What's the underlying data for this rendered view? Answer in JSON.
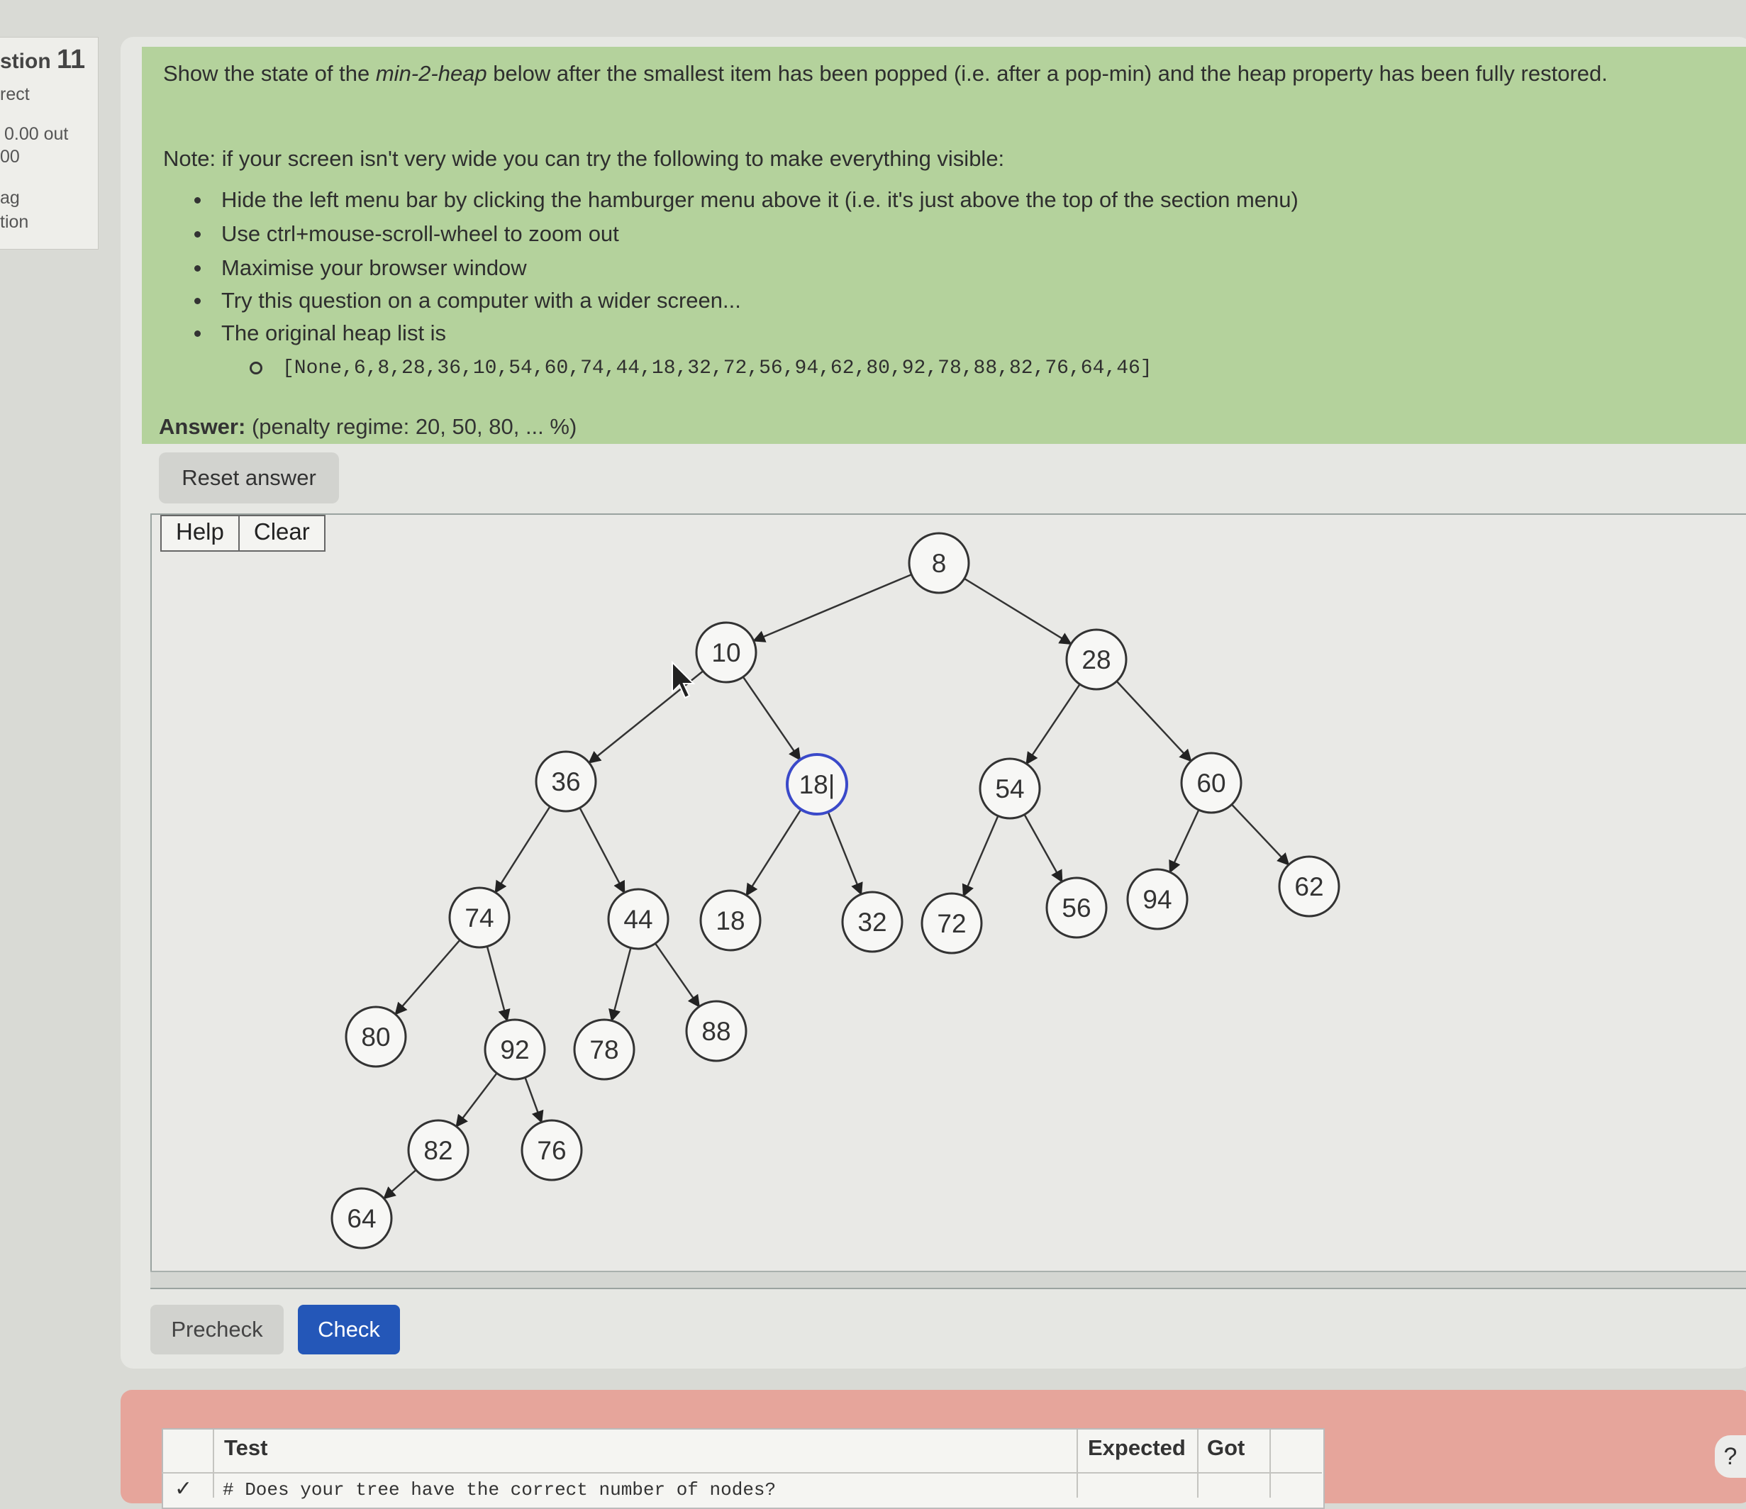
{
  "sidebar": {
    "question_word": "stion",
    "question_number": "11",
    "status": "rect",
    "mark": "0.00 out",
    "mark_total": "00",
    "flag_line1": "ag",
    "flag_line2": "tion"
  },
  "question": {
    "prompt_before": "Show the state of the ",
    "prompt_emph": "min-2-heap",
    "prompt_after": " below after the smallest item has been popped (i.e. after a pop-min) and the heap property has been fully restored.",
    "note": "Note: if your screen isn't very wide you can try the following to make everything visible:",
    "bullets": [
      "Hide the left menu bar by clicking the hamburger menu above it (i.e. it's just above the top of the section menu)",
      "Use ctrl+mouse-scroll-wheel to zoom out",
      "Maximise your browser window",
      "Try this question on a computer with a wider screen...",
      "The original heap list is"
    ],
    "heap_list": "[None,6,8,28,36,10,54,60,74,44,18,32,72,56,94,62,80,92,78,88,82,76,64,46]",
    "answer_label": "Answer:",
    "penalty": "(penalty regime: 20, 50, 80, ... %)"
  },
  "editor": {
    "reset_label": "Reset answer",
    "help_label": "Help",
    "clear_label": "Clear"
  },
  "tree": {
    "nodes": [
      {
        "id": "n8",
        "label": "8",
        "selected": false
      },
      {
        "id": "n10",
        "label": "10",
        "selected": false
      },
      {
        "id": "n28",
        "label": "28",
        "selected": false
      },
      {
        "id": "n36",
        "label": "36",
        "selected": false
      },
      {
        "id": "n18a",
        "label": "18|",
        "selected": true
      },
      {
        "id": "n54",
        "label": "54",
        "selected": false
      },
      {
        "id": "n60",
        "label": "60",
        "selected": false
      },
      {
        "id": "n74",
        "label": "74",
        "selected": false
      },
      {
        "id": "n44",
        "label": "44",
        "selected": false
      },
      {
        "id": "n18b",
        "label": "18",
        "selected": false
      },
      {
        "id": "n32",
        "label": "32",
        "selected": false
      },
      {
        "id": "n72",
        "label": "72",
        "selected": false
      },
      {
        "id": "n56",
        "label": "56",
        "selected": false
      },
      {
        "id": "n94",
        "label": "94",
        "selected": false
      },
      {
        "id": "n62",
        "label": "62",
        "selected": false
      },
      {
        "id": "n80",
        "label": "80",
        "selected": false
      },
      {
        "id": "n92",
        "label": "92",
        "selected": false
      },
      {
        "id": "n78",
        "label": "78",
        "selected": false
      },
      {
        "id": "n88",
        "label": "88",
        "selected": false
      },
      {
        "id": "n82",
        "label": "82",
        "selected": false
      },
      {
        "id": "n76",
        "label": "76",
        "selected": false
      },
      {
        "id": "n64",
        "label": "64",
        "selected": false
      }
    ],
    "edges": [
      [
        "n8",
        "n10"
      ],
      [
        "n8",
        "n28"
      ],
      [
        "n10",
        "n36"
      ],
      [
        "n10",
        "n18a"
      ],
      [
        "n28",
        "n54"
      ],
      [
        "n28",
        "n60"
      ],
      [
        "n36",
        "n74"
      ],
      [
        "n36",
        "n44"
      ],
      [
        "n18a",
        "n18b"
      ],
      [
        "n18a",
        "n32"
      ],
      [
        "n54",
        "n72"
      ],
      [
        "n54",
        "n56"
      ],
      [
        "n60",
        "n94"
      ],
      [
        "n60",
        "n62"
      ],
      [
        "n74",
        "n80"
      ],
      [
        "n74",
        "n92"
      ],
      [
        "n44",
        "n78"
      ],
      [
        "n44",
        "n88"
      ],
      [
        "n92",
        "n82"
      ],
      [
        "n92",
        "n76"
      ],
      [
        "n82",
        "n64"
      ]
    ]
  },
  "actions": {
    "precheck_label": "Precheck",
    "check_label": "Check"
  },
  "results": {
    "headers": [
      "Test",
      "Expected",
      "Got"
    ],
    "row_text": "# Does your tree have the correct number of nodes?",
    "help_symbol": "?"
  }
}
